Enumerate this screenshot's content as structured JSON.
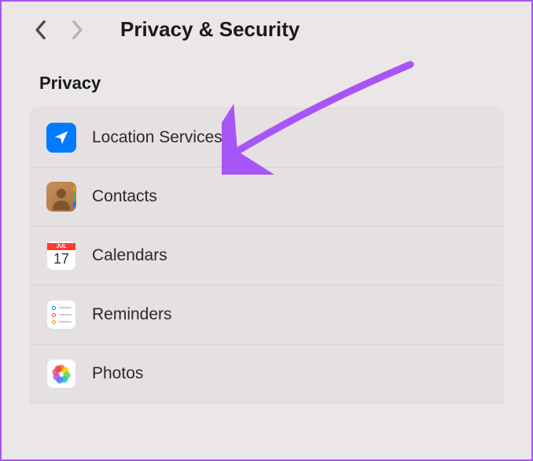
{
  "header": {
    "title": "Privacy & Security"
  },
  "section": {
    "title": "Privacy"
  },
  "items": [
    {
      "label": "Location Services",
      "icon": "location"
    },
    {
      "label": "Contacts",
      "icon": "contacts"
    },
    {
      "label": "Calendars",
      "icon": "calendar",
      "cal_month": "JUL",
      "cal_day": "17"
    },
    {
      "label": "Reminders",
      "icon": "reminders"
    },
    {
      "label": "Photos",
      "icon": "photos"
    }
  ],
  "annotation": {
    "arrow_color": "#a855f7"
  }
}
